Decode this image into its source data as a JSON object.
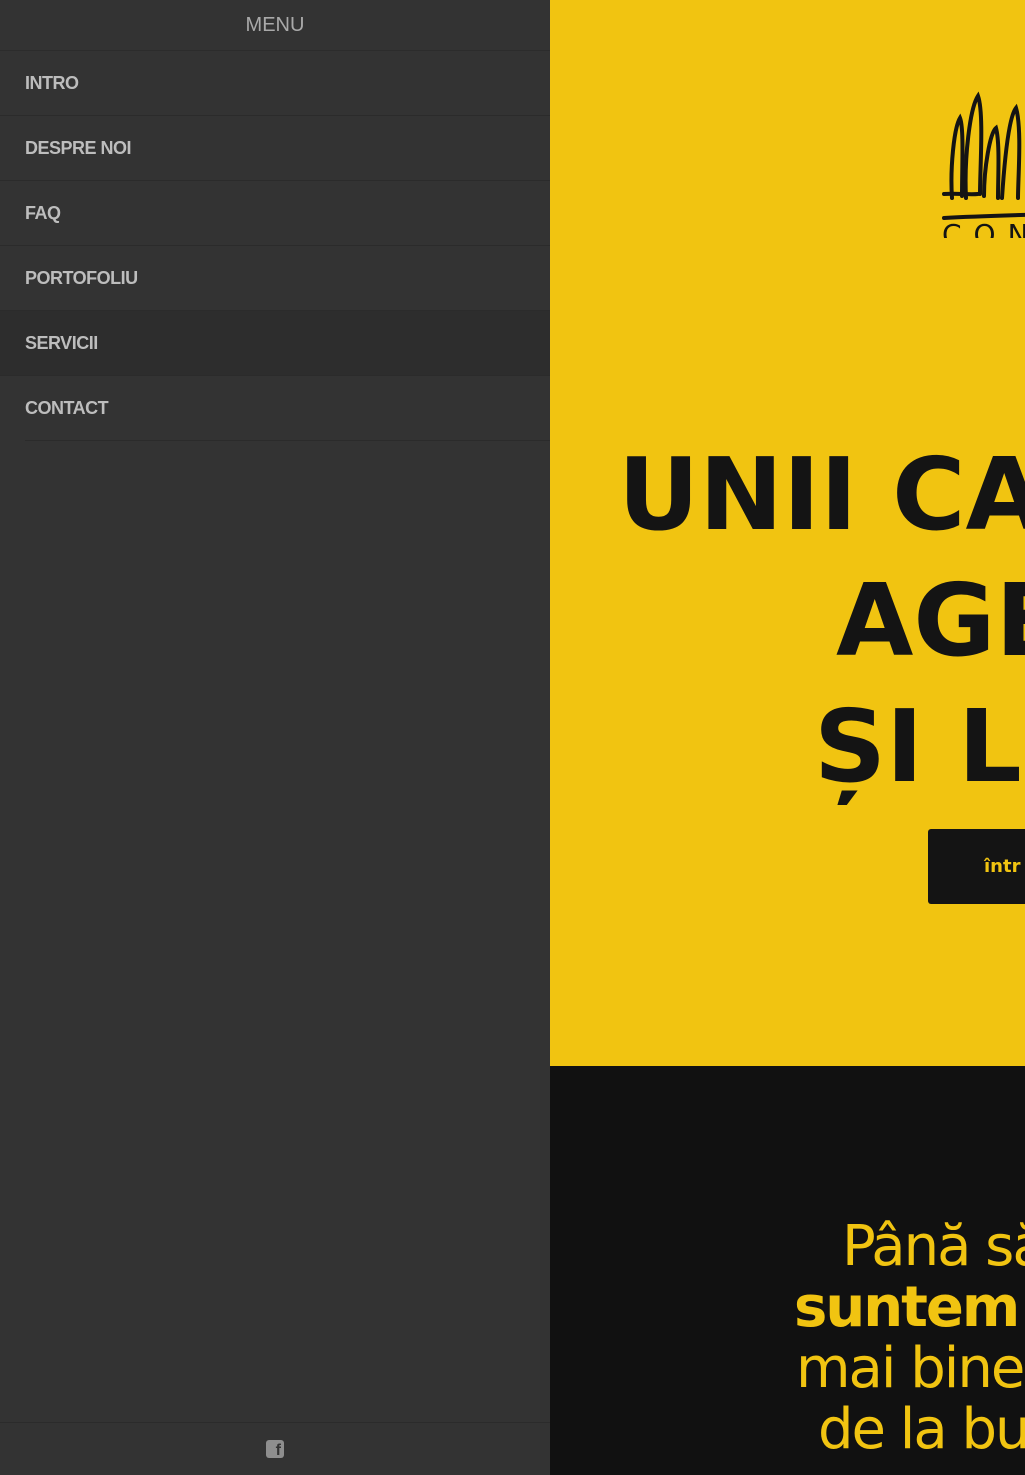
{
  "sidebar": {
    "title": "MENU",
    "items": [
      {
        "label": "INTRO"
      },
      {
        "label": "DESPRE NOI"
      },
      {
        "label": "FAQ"
      },
      {
        "label": "PORTOFOLIU"
      },
      {
        "label": "SERVICII",
        "active": true
      },
      {
        "label": "CONTACT"
      }
    ],
    "footer_icon": "facebook-icon"
  },
  "hero": {
    "logo_text": "CON",
    "headline_lines": [
      "UNII CA",
      "AGE",
      "ȘI LE"
    ],
    "cta_label": "într",
    "background": "#f1c411"
  },
  "intro": {
    "lines": [
      "Până să",
      "suntem c",
      "mai bine s",
      "de la bur"
    ],
    "text_color": "#f1c411",
    "background": "#111111"
  },
  "colors": {
    "sidebar_bg": "#333333",
    "sidebar_text": "#bdbdbd",
    "accent": "#f1c411"
  }
}
